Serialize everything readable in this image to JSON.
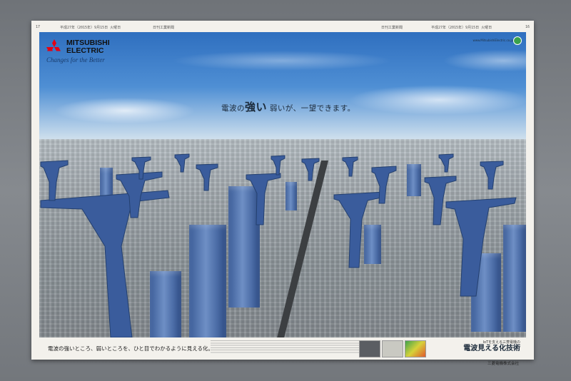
{
  "newspaper": {
    "left_folio": "17",
    "right_folio": "16",
    "date_left": "平成27年（2015年）9月15日 火曜日",
    "paper_name": "日刊工業新聞",
    "date_right": "平成27年（2015年）9月15日 火曜日"
  },
  "ad": {
    "brand_name_line1": "MITSUBISHI",
    "brand_name_line2": "ELECTRIC",
    "tagline": "Changes for the Better",
    "headline_prefix": "電波の",
    "headline_emphasis": "強い",
    "headline_suffix": " 弱いが、一望できます。",
    "footer_caption": "電波の強いところ、弱いところを、ひと目でわかるように見える化。",
    "product_subtitle": "IoTを支える三菱電機の",
    "product_title": "電波見える化技術",
    "company": "三菱電機株式会社",
    "corner_url": "www.MitsubishiElectric.co.jp"
  },
  "colors": {
    "logo_red": "#e60012",
    "pylon_blue": "#3a5c9c",
    "sky_blue": "#3b7bc8",
    "sheet": "#f3f1ec"
  }
}
